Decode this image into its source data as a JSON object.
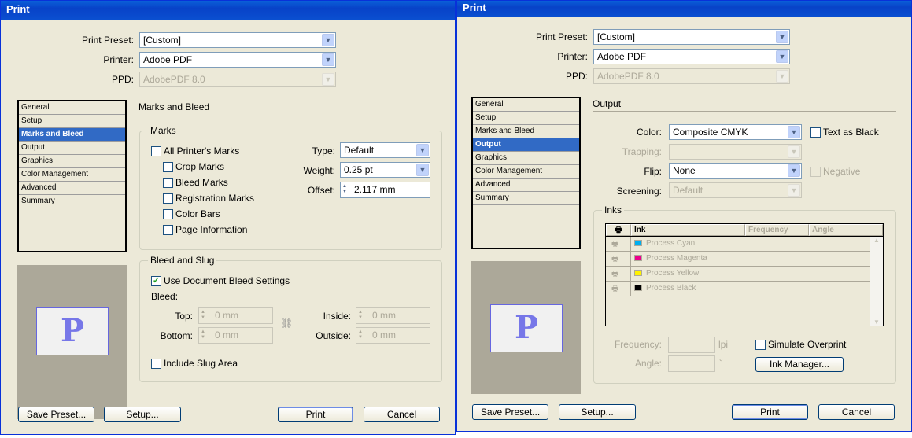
{
  "left": {
    "title": "Print",
    "preset_label": "Print Preset:",
    "preset_value": "[Custom]",
    "printer_label": "Printer:",
    "printer_value": "Adobe PDF",
    "ppd_label": "PPD:",
    "ppd_value": "AdobePDF 8.0",
    "nav": [
      "General",
      "Setup",
      "Marks and Bleed",
      "Output",
      "Graphics",
      "Color Management",
      "Advanced",
      "Summary"
    ],
    "selected_nav": "Marks and Bleed",
    "preview_letter": "P",
    "section_title": "Marks and Bleed",
    "marks_legend": "Marks",
    "marks": {
      "all": "All Printer's Marks",
      "crop": "Crop Marks",
      "bleed": "Bleed Marks",
      "registration": "Registration Marks",
      "color_bars": "Color Bars",
      "page_info": "Page Information"
    },
    "type_label": "Type:",
    "type_value": "Default",
    "weight_label": "Weight:",
    "weight_value": "0.25 pt",
    "offset_label": "Offset:",
    "offset_value": "2.117 mm",
    "bleed_legend": "Bleed and Slug",
    "use_doc_bleed": "Use Document Bleed Settings",
    "use_doc_bleed_checked": true,
    "bleed_label": "Bleed:",
    "top_label": "Top:",
    "top_value": "0 mm",
    "bottom_label": "Bottom:",
    "bottom_value": "0 mm",
    "inside_label": "Inside:",
    "inside_value": "0 mm",
    "outside_label": "Outside:",
    "outside_value": "0 mm",
    "include_slug": "Include Slug Area",
    "buttons": {
      "save_preset": "Save Preset...",
      "setup": "Setup...",
      "print": "Print",
      "cancel": "Cancel"
    }
  },
  "right": {
    "title": "Print",
    "preset_label": "Print Preset:",
    "preset_value": "[Custom]",
    "printer_label": "Printer:",
    "printer_value": "Adobe PDF",
    "ppd_label": "PPD:",
    "ppd_value": "AdobePDF 8.0",
    "nav": [
      "General",
      "Setup",
      "Marks and Bleed",
      "Output",
      "Graphics",
      "Color Management",
      "Advanced",
      "Summary"
    ],
    "selected_nav": "Output",
    "preview_letter": "P",
    "section_title": "Output",
    "color_label": "Color:",
    "color_value": "Composite CMYK",
    "text_as_black": "Text as Black",
    "trapping_label": "Trapping:",
    "trapping_value": "",
    "flip_label": "Flip:",
    "flip_value": "None",
    "negative": "Negative",
    "screening_label": "Screening:",
    "screening_value": "Default",
    "inks_legend": "Inks",
    "ink_headers": [
      "Ink",
      "Frequency",
      "Angle"
    ],
    "inks": [
      {
        "name": "Process Cyan",
        "color": "#00aeef"
      },
      {
        "name": "Process Magenta",
        "color": "#ec008c"
      },
      {
        "name": "Process Yellow",
        "color": "#fff200"
      },
      {
        "name": "Process Black",
        "color": "#000000"
      }
    ],
    "frequency_label": "Frequency:",
    "frequency_unit": "lpi",
    "angle_label": "Angle:",
    "angle_unit": "°",
    "simulate_overprint": "Simulate Overprint",
    "ink_manager": "Ink Manager...",
    "buttons": {
      "save_preset": "Save Preset...",
      "setup": "Setup...",
      "print": "Print",
      "cancel": "Cancel"
    }
  }
}
